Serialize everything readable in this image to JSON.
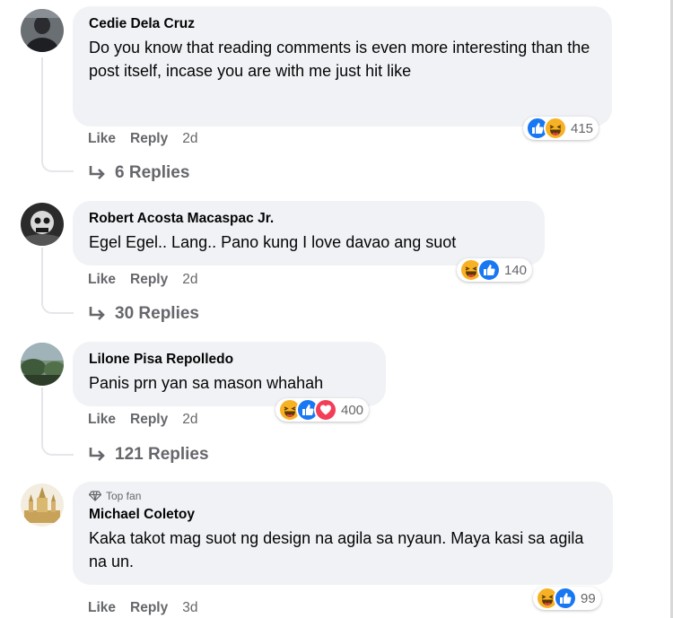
{
  "comments": [
    {
      "author": "Cedie Dela Cruz",
      "text": "Do you know that reading comments is even more interesting than the post itself, incase you are with me just hit like",
      "reactions": [
        "like",
        "haha"
      ],
      "reaction_count": "415",
      "like_label": "Like",
      "reply_label": "Reply",
      "time": "2d",
      "replies_label": "6 Replies"
    },
    {
      "author": "Robert Acosta Macaspac Jr.",
      "text": "Egel Egel.. Lang.. Pano kung I love davao ang suot",
      "reactions": [
        "haha",
        "like"
      ],
      "reaction_count": "140",
      "like_label": "Like",
      "reply_label": "Reply",
      "time": "2d",
      "replies_label": "30 Replies"
    },
    {
      "author": "Lilone Pisa Repolledo",
      "text": "Panis prn yan sa mason whahah",
      "reactions": [
        "haha",
        "like",
        "love"
      ],
      "reaction_count": "400",
      "like_label": "Like",
      "reply_label": "Reply",
      "time": "2d",
      "replies_label": "121 Replies"
    },
    {
      "badge": "Top fan",
      "author": "Michael Coletoy",
      "text": "Kaka takot mag suot ng design na agila sa nyaun. Maya kasi sa agila na un.",
      "reactions": [
        "haha",
        "like"
      ],
      "reaction_count": "99",
      "like_label": "Like",
      "reply_label": "Reply",
      "time": "3d"
    }
  ],
  "colors": {
    "bubble": "#f0f2f5",
    "meta": "#65676b",
    "like_blue": "#1877f2",
    "haha_yellow": "#f7b125",
    "love_red": "#f33e58"
  }
}
